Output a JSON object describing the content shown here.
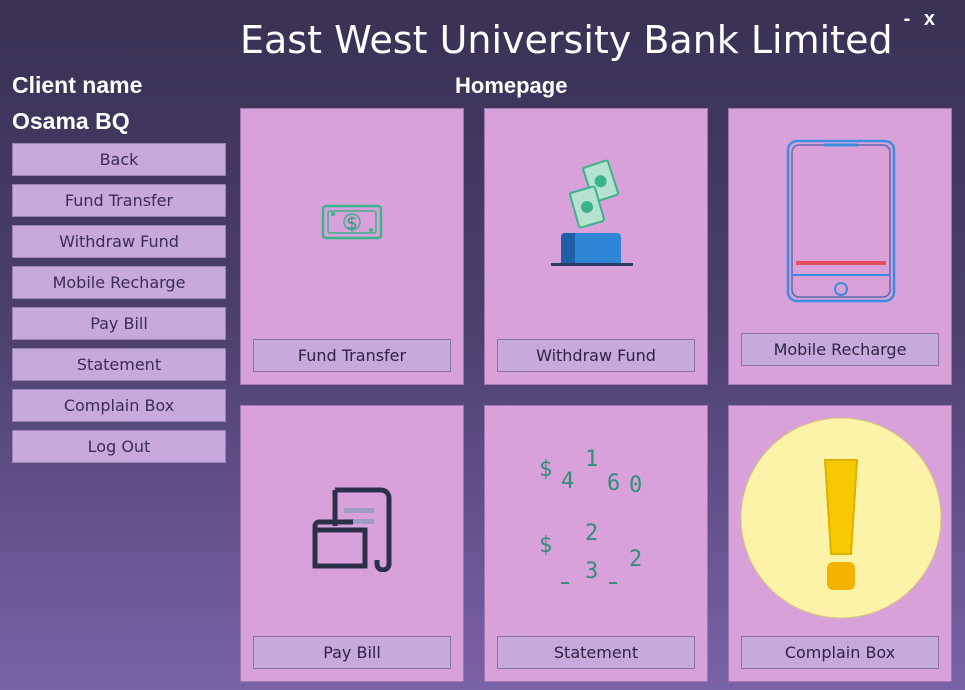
{
  "window": {
    "minimize": "-",
    "close": "x"
  },
  "app": {
    "title": "East West University Bank Limited"
  },
  "client": {
    "label": "Client name",
    "name": "Osama BQ"
  },
  "page": {
    "heading": "Homepage"
  },
  "sidebar": {
    "items": [
      {
        "label": "Back"
      },
      {
        "label": "Fund Transfer"
      },
      {
        "label": "Withdraw Fund"
      },
      {
        "label": "Mobile Recharge"
      },
      {
        "label": "Pay Bill"
      },
      {
        "label": "Statement"
      },
      {
        "label": "Complain Box"
      },
      {
        "label": "Log Out"
      }
    ]
  },
  "cards": [
    {
      "label": "Fund Transfer",
      "icon": "banknote-icon"
    },
    {
      "label": "Withdraw Fund",
      "icon": "wallet-cash-icon"
    },
    {
      "label": "Mobile Recharge",
      "icon": "smartphone-icon"
    },
    {
      "label": "Pay Bill",
      "icon": "bill-document-icon"
    },
    {
      "label": "Statement",
      "icon": "statement-numbers-icon"
    },
    {
      "label": "Complain Box",
      "icon": "exclamation-icon"
    }
  ],
  "statement_icon_text": {
    "line1": [
      "$",
      "4",
      "1",
      "6",
      "0"
    ],
    "line2": [
      "$",
      "2",
      "3",
      "2"
    ]
  },
  "colors": {
    "card_bg": "#d9a1da",
    "button_bg": "#c6a9dd",
    "money_green": "#3ab38a",
    "wallet_blue": "#2f86d6",
    "phone_blue": "#3a8de0",
    "alert_red": "#e05060",
    "alert_circle": "#fdf3a8",
    "alert_yellow": "#f5c800"
  }
}
